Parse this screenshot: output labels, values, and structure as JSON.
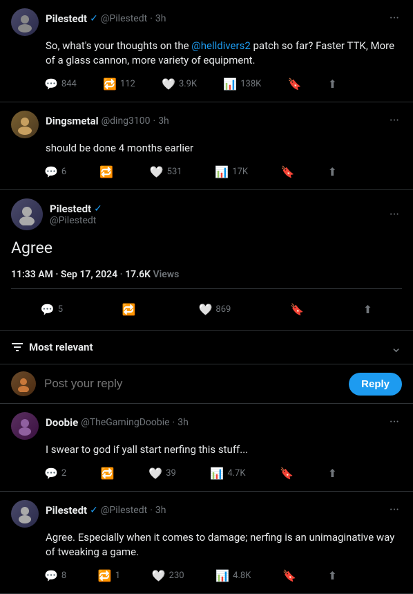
{
  "tweets": [
    {
      "id": "tweet1",
      "username": "Pilestedt",
      "verified": true,
      "handle": "@Pilestedt",
      "time": "3h",
      "body_parts": [
        {
          "type": "text",
          "text": "So, what's your thoughts on the "
        },
        {
          "type": "mention",
          "text": "@helldivers2"
        },
        {
          "type": "text",
          "text": " patch so far? Faster TTK, More of a glass cannon, more variety of equipment."
        }
      ],
      "stats": {
        "comments": "844",
        "retweets": "112",
        "likes": "3.9K",
        "views": "138K"
      },
      "avatar_type": "pilestedt"
    },
    {
      "id": "tweet2",
      "username": "Dingsmetal",
      "verified": false,
      "handle": "@ding3100",
      "time": "3h",
      "body": "should be done 4 months earlier",
      "stats": {
        "comments": "6",
        "retweets": "",
        "likes": "531",
        "views": "17K"
      },
      "avatar_type": "metal"
    }
  ],
  "main_tweet": {
    "username": "Pilestedt",
    "verified": true,
    "handle": "@Pilestedt",
    "body": "Agree",
    "timestamp": "11:33 AM · Sep 17, 2024",
    "views_label": "17.6K",
    "views_text": "Views",
    "stats": {
      "comments": "5",
      "retweets": "",
      "likes": "869"
    },
    "avatar_type": "pilestedt"
  },
  "sort": {
    "label": "Most relevant",
    "icon": "filter-icon"
  },
  "reply_input": {
    "placeholder": "Post your reply",
    "button_label": "Reply"
  },
  "comments": [
    {
      "id": "comment1",
      "username": "Doobie",
      "verified": false,
      "handle": "@TheGamingDoobie",
      "time": "3h",
      "body": "I swear to god if yall start nerfing this stuff...",
      "stats": {
        "comments": "2",
        "retweets": "",
        "likes": "39",
        "views": "4.7K"
      },
      "avatar_type": "doobie"
    },
    {
      "id": "comment2",
      "username": "Pilestedt",
      "verified": true,
      "handle": "@Pilestedt",
      "time": "3h",
      "body": "Agree. Especially when it comes to damage; nerfing is an unimaginative way of tweaking a game.",
      "stats": {
        "comments": "8",
        "retweets": "1",
        "likes": "230",
        "views": "4.8K"
      },
      "avatar_type": "pilestedt"
    }
  ]
}
